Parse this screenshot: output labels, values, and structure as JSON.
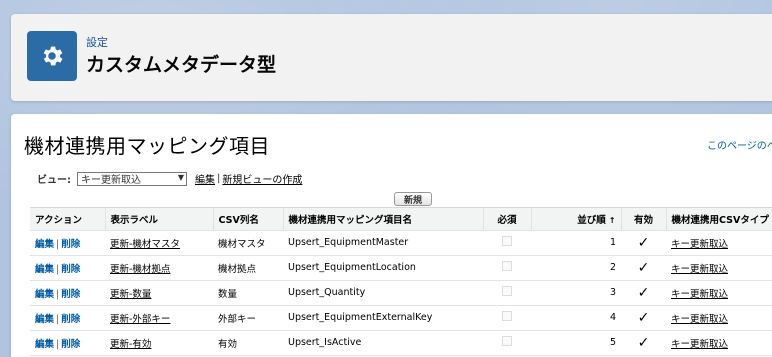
{
  "header": {
    "breadcrumb": "設定",
    "title": "カスタムメタデータ型",
    "icon": "gear-icon",
    "icon_bg": "#2b6ca6"
  },
  "list": {
    "title": "機材連携用マッピング項目",
    "help_link": "このページのヘル",
    "view_label": "ビュー:",
    "view_selected": "キー更新取込",
    "edit_link": "編集",
    "new_view_link": "新規ビューの作成",
    "new_button": "新規"
  },
  "table": {
    "columns": [
      "アクション",
      "表示ラベル",
      "CSV列名",
      "機材連携用マッピング項目名",
      "必須",
      "並び順",
      "有効",
      "機材連携用CSVタイプ"
    ],
    "sort_indicator": "↑",
    "action_edit": "編集",
    "action_separator": "|",
    "action_delete": "削除",
    "rows": [
      {
        "label": "更新-機材マスタ",
        "csv": "機材マスタ",
        "name": "Upsert_EquipmentMaster",
        "order": "1",
        "type": "キー更新取込"
      },
      {
        "label": "更新-機材拠点",
        "csv": "機材拠点",
        "name": "Upsert_EquipmentLocation",
        "order": "2",
        "type": "キー更新取込"
      },
      {
        "label": "更新-数量",
        "csv": "数量",
        "name": "Upsert_Quantity",
        "order": "3",
        "type": "キー更新取込"
      },
      {
        "label": "更新-外部キー",
        "csv": "外部キー",
        "name": "Upsert_EquipmentExternalKey",
        "order": "4",
        "type": "キー更新取込"
      },
      {
        "label": "更新-有効",
        "csv": "有効",
        "name": "Upsert_IsActive",
        "order": "5",
        "type": "キー更新取込"
      }
    ]
  }
}
